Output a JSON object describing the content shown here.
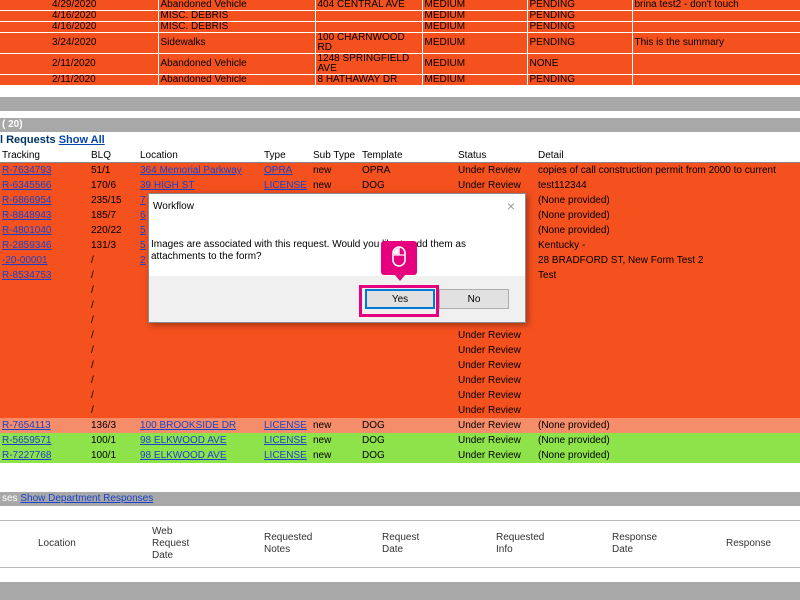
{
  "top_rows": [
    {
      "date": "4/29/2020",
      "type": "Abandoned Vehicle",
      "location": "404 CENTRAL AVE",
      "priority": "MEDIUM",
      "status": "PENDING",
      "note": "brina test2 - don't touch"
    },
    {
      "date": "4/16/2020",
      "type": "MISC. DEBRIS",
      "location": "",
      "priority": "MEDIUM",
      "status": "PENDING",
      "note": ""
    },
    {
      "date": "4/16/2020",
      "type": "MISC. DEBRIS",
      "location": "",
      "priority": "MEDIUM",
      "status": "PENDING",
      "note": ""
    },
    {
      "date": "3/24/2020",
      "type": "Sidewalks",
      "location": "100 CHARNWOOD RD",
      "priority": "MEDIUM",
      "status": "PENDING",
      "note": "This is the summary"
    },
    {
      "date": "2/11/2020",
      "type": "Abandoned Vehicle",
      "location": "1248 SPRINGFIELD AVE",
      "priority": "MEDIUM",
      "status": "NONE",
      "note": ""
    },
    {
      "date": "2/11/2020",
      "type": "Abandoned Vehicle",
      "location": "8 HATHAWAY DR",
      "priority": "MEDIUM",
      "status": "PENDING",
      "note": ""
    }
  ],
  "band_label": "( 20)",
  "section": {
    "title": "l Requests",
    "show_all": "Show All"
  },
  "columns": [
    "Tracking",
    "BLQ",
    "Location",
    "Type",
    "Sub Type",
    "Template",
    "Status",
    "Detail"
  ],
  "rows": [
    {
      "style": "red",
      "tracking": "R-7634793",
      "blq": "51/1",
      "location": "364 Memorial Parkway",
      "type": "OPRA",
      "subtype": "new",
      "template": "OPRA",
      "status": "Under Review",
      "detail": "copies of call construction permit from 2000 to current"
    },
    {
      "style": "red",
      "tracking": "R-6345566",
      "blq": "170/6",
      "location": "39 HIGH ST",
      "type": "LICENSE",
      "subtype": "new",
      "template": "DOG",
      "status": "Under Review",
      "detail": "test112344"
    },
    {
      "style": "red",
      "tracking": "R-6866954",
      "blq": "235/15",
      "location": "7",
      "type": "",
      "subtype": "",
      "template": "",
      "status": "",
      "detail": "(None provided)"
    },
    {
      "style": "red",
      "tracking": "R-8848943",
      "blq": "185/7",
      "location": "6",
      "type": "",
      "subtype": "",
      "template": "",
      "status": "",
      "detail": "(None provided)"
    },
    {
      "style": "red",
      "tracking": "R-4801040",
      "blq": "220/22",
      "location": "5",
      "type": "",
      "subtype": "",
      "template": "",
      "status": "",
      "detail": "(None provided)"
    },
    {
      "style": "red",
      "tracking": "R-2859346",
      "blq": "131/3",
      "location": "5",
      "type": "",
      "subtype": "",
      "template": "",
      "status": "",
      "detail": "Kentucky -"
    },
    {
      "style": "red",
      "tracking": "-20-00001",
      "blq": "/",
      "location": "2",
      "type": "",
      "subtype": "",
      "template": "",
      "status": "",
      "detail": "28 BRADFORD ST, New Form Test 2"
    },
    {
      "style": "red",
      "tracking": "R-8534753",
      "blq": "/",
      "location": "",
      "type": "",
      "subtype": "",
      "template": "",
      "status": "",
      "detail": "Test"
    },
    {
      "style": "red",
      "tracking": "",
      "blq": "/",
      "location": "",
      "type": "",
      "subtype": "",
      "template": "",
      "status": "",
      "detail": ""
    },
    {
      "style": "red",
      "tracking": "",
      "blq": "/",
      "location": "",
      "type": "",
      "subtype": "",
      "template": "",
      "status": "",
      "detail": ""
    },
    {
      "style": "red",
      "tracking": "",
      "blq": "/",
      "location": "",
      "type": "",
      "subtype": "",
      "template": "",
      "status": "Under Review",
      "detail": ""
    },
    {
      "style": "red",
      "tracking": "",
      "blq": "/",
      "location": "",
      "type": "",
      "subtype": "",
      "template": "",
      "status": "Under Review",
      "detail": ""
    },
    {
      "style": "red",
      "tracking": "",
      "blq": "/",
      "location": "",
      "type": "",
      "subtype": "",
      "template": "",
      "status": "Under Review",
      "detail": ""
    },
    {
      "style": "red",
      "tracking": "",
      "blq": "/",
      "location": "",
      "type": "",
      "subtype": "",
      "template": "",
      "status": "Under Review",
      "detail": ""
    },
    {
      "style": "red",
      "tracking": "",
      "blq": "/",
      "location": "",
      "type": "",
      "subtype": "",
      "template": "",
      "status": "Under Review",
      "detail": ""
    },
    {
      "style": "red",
      "tracking": "",
      "blq": "/",
      "location": "",
      "type": "",
      "subtype": "",
      "template": "",
      "status": "Under Review",
      "detail": ""
    },
    {
      "style": "red",
      "tracking": "",
      "blq": "/",
      "location": "",
      "type": "",
      "subtype": "",
      "template": "",
      "status": "Under Review",
      "detail": ""
    },
    {
      "style": "salmon",
      "tracking": "R-7654113",
      "blq": "136/3",
      "location": "100 BROOKSIDE DR",
      "type": "LICENSE",
      "subtype": "new",
      "template": "DOG",
      "status": "Under Review",
      "detail": "(None provided)"
    },
    {
      "style": "green",
      "tracking": "R-5659571",
      "blq": "100/1",
      "location": "98 ELKWOOD AVE",
      "type": "LICENSE",
      "subtype": "new",
      "template": "DOG",
      "status": "Under Review",
      "detail": "(None provided)"
    },
    {
      "style": "green",
      "tracking": "R-7227768",
      "blq": "100/1",
      "location": "98 ELKWOOD AVE",
      "type": "LICENSE",
      "subtype": "new",
      "template": "DOG",
      "status": "Under Review",
      "detail": "(None provided)"
    }
  ],
  "dept": {
    "prefix": "ses",
    "link": "Show Department Responses",
    "headers": [
      "Location",
      "Web Request Date",
      "Requested Notes",
      "Request Date",
      "Requested Info",
      "Response Date",
      "Response"
    ]
  },
  "dialog": {
    "title": "Workflow",
    "close": "×",
    "message": "Images are associated with this request.  Would you like to add them as attachments to the form?",
    "yes": "Yes",
    "no": "No"
  },
  "colors": {
    "red": "#f4511e",
    "salmon": "#f58c6a",
    "green": "#8ee34a",
    "highlight": "#e6007e"
  },
  "icons": {
    "cursor": "mouse-icon"
  }
}
